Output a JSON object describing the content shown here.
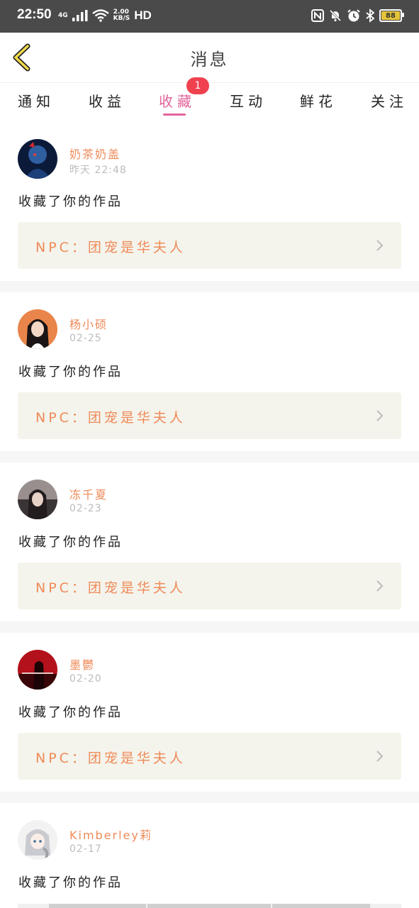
{
  "status_bar": {
    "time": "22:50",
    "network": "4G",
    "speed_value": "2.00",
    "speed_unit": "KB/S",
    "hd": "HD",
    "battery": "88"
  },
  "header": {
    "title": "消息"
  },
  "tabs": [
    {
      "label": "通知",
      "active": false
    },
    {
      "label": "收益",
      "active": false
    },
    {
      "label": "收藏",
      "active": true,
      "badge": "1"
    },
    {
      "label": "互动",
      "active": false
    },
    {
      "label": "鲜花",
      "active": false
    },
    {
      "label": "关注",
      "active": false
    }
  ],
  "messages": [
    {
      "user": "奶茶奶盖",
      "date": "昨天 22:48",
      "action": "收藏了你的作品",
      "work": "NPC：团宠是华夫人"
    },
    {
      "user": "杨小硕",
      "date": "02-25",
      "action": "收藏了你的作品",
      "work": "NPC：团宠是华夫人"
    },
    {
      "user": "冻千夏",
      "date": "02-23",
      "action": "收藏了你的作品",
      "work": "NPC：团宠是华夫人"
    },
    {
      "user": "墨鬱",
      "date": "02-20",
      "action": "收藏了你的作品",
      "work": "NPC：团宠是华夫人"
    },
    {
      "user": "Kimberley莉",
      "date": "02-17",
      "action": "收藏了你的作品"
    }
  ],
  "colors": {
    "accent": "#e2639a",
    "name": "#ef8a58",
    "badge": "#f0414f"
  }
}
